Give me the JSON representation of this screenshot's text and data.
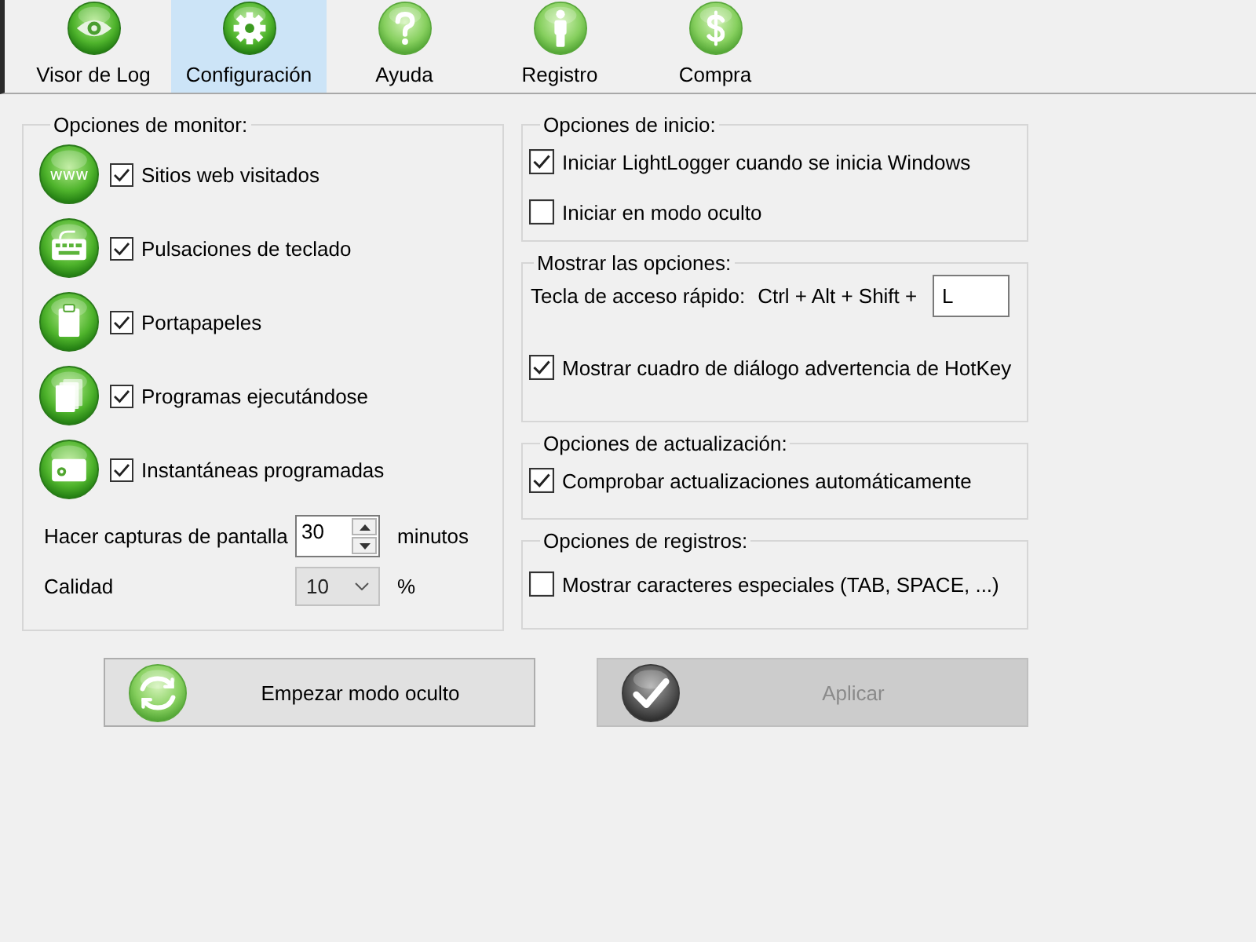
{
  "toolbar": {
    "tabs": [
      {
        "label": "Visor de Log",
        "kind": "eye",
        "selected": false
      },
      {
        "label": "Configuración",
        "kind": "gear",
        "selected": true
      },
      {
        "label": "Ayuda",
        "kind": "help",
        "selected": false
      },
      {
        "label": "Registro",
        "kind": "person",
        "selected": false
      },
      {
        "label": "Compra",
        "kind": "dollar",
        "selected": false
      }
    ]
  },
  "monitor_options": {
    "title": "Opciones de monitor:",
    "items": [
      {
        "kind": "www",
        "icon_text": "www",
        "label": "Sitios web visitados",
        "checked": true
      },
      {
        "kind": "keyboard",
        "label": "Pulsaciones de teclado",
        "checked": true
      },
      {
        "kind": "clipboard",
        "label": "Portapapeles",
        "checked": true
      },
      {
        "kind": "programs",
        "label": "Programas ejecutándose",
        "checked": true
      },
      {
        "kind": "camera",
        "label": "Instantáneas programadas",
        "checked": true
      }
    ],
    "capture_interval": {
      "label": "Hacer capturas de pantalla",
      "value": "30",
      "unit": "minutos"
    },
    "quality": {
      "label": "Calidad",
      "value": "10",
      "unit": "%"
    }
  },
  "startup_options": {
    "title": "Opciones de inicio:",
    "items": [
      {
        "label": "Iniciar LightLogger cuando se inicia Windows",
        "checked": true
      },
      {
        "label": "Iniciar en modo oculto",
        "checked": false
      }
    ]
  },
  "display_options": {
    "title": "Mostrar las opciones:",
    "hotkey": {
      "label": "Tecla de acceso rápido:",
      "modifiers": "Ctrl + Alt + Shift +",
      "value": "L"
    },
    "items": [
      {
        "label": "Mostrar cuadro de diálogo advertencia de HotKey",
        "checked": true
      }
    ]
  },
  "update_options": {
    "title": "Opciones de actualización:",
    "items": [
      {
        "label": "Comprobar actualizaciones automáticamente",
        "checked": true
      }
    ]
  },
  "log_options": {
    "title": "Opciones de registros:",
    "items": [
      {
        "label": "Mostrar caracteres especiales (TAB, SPACE, ...)",
        "checked": false
      }
    ]
  },
  "buttons": [
    {
      "label": "Empezar modo oculto",
      "kind": "refresh",
      "disabled": false
    },
    {
      "label": "Aplicar",
      "kind": "check",
      "disabled": true
    }
  ]
}
